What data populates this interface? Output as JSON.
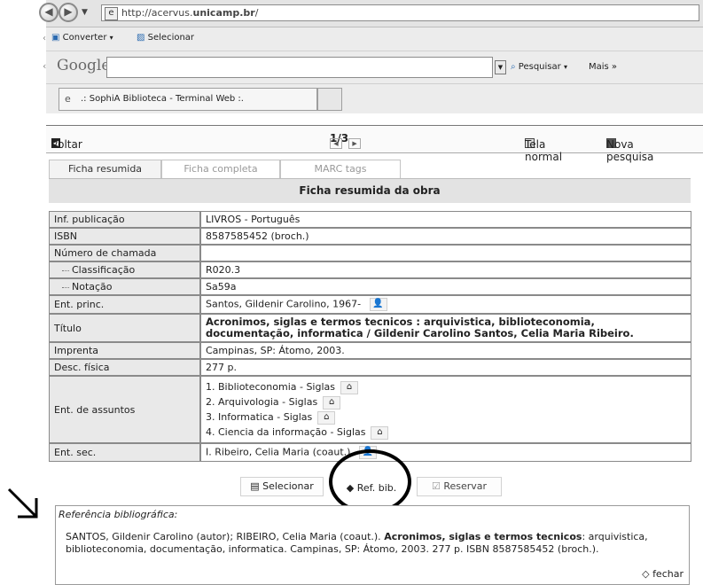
{
  "browser": {
    "url_prefix": "http://acervus.",
    "url_host": "unicamp.br",
    "url_suffix": "/",
    "toolbar": {
      "converter_label": "Converter",
      "selecionar_label": "Selecionar",
      "google_logo": "Google",
      "pesquisar_label": "Pesquisar",
      "mais_label": "Mais »"
    },
    "tab_title": ".: SophiA Biblioteca - Terminal Web :."
  },
  "page_toolbar": {
    "back_label": "voltar",
    "pager": "1/3",
    "tela_normal_label": "Tela normal",
    "nova_pesquisa_label": "Nova pesquisa"
  },
  "tabs": [
    {
      "label": "Ficha resumida"
    },
    {
      "label": "Ficha completa"
    },
    {
      "label": "MARC tags"
    }
  ],
  "section_title": "Ficha resumida da obra",
  "record": {
    "inf_publicacao_label": "Inf. publicação",
    "inf_publicacao_value": "LIVROS - Português",
    "isbn_label": "ISBN",
    "isbn_value": "8587585452 (broch.)",
    "numero_chamada_label": "Número de chamada",
    "classificacao_label": "Classificação",
    "classificacao_value": "R020.3",
    "notacao_label": "Notação",
    "notacao_value": "Sa59a",
    "ent_princ_label": "Ent. princ.",
    "ent_princ_value": "Santos, Gildenir Carolino, 1967-",
    "titulo_label": "Título",
    "titulo_value": "Acronimos, siglas e termos tecnicos : arquivistica, biblioteconomia, documentação, informatica / Gildenir Carolino Santos, Celia Maria Ribeiro.",
    "imprenta_label": "Imprenta",
    "imprenta_value": "Campinas, SP: Átomo, 2003.",
    "desc_fisica_label": "Desc. física",
    "desc_fisica_value": "277 p.",
    "ent_assuntos_label": "Ent. de assuntos",
    "assuntos": [
      "1. Biblioteconomia - Siglas",
      "2. Arquivologia - Siglas",
      "3. Informatica - Siglas",
      "4. Ciencia da informação - Siglas"
    ],
    "ent_sec_label": "Ent. sec.",
    "ent_sec_value": "I. Ribeiro, Celia Maria (coaut.)"
  },
  "actions": {
    "selecionar_label": "Selecionar",
    "ref_bib_label": "Ref. bib.",
    "reservar_label": "Reservar"
  },
  "reference": {
    "title": "Referência bibliográfica:",
    "text_prefix": "SANTOS, Gildenir Carolino (autor); RIBEIRO, Celia Maria (coaut.). ",
    "text_bold": "Acronimos, siglas e termos tecnicos",
    "text_suffix": ": arquivistica, biblioteconomia, documentação, informatica. Campinas, SP: Átomo, 2003. 277 p. ISBN 8587585452 (broch.).",
    "close_label": "fechar"
  }
}
